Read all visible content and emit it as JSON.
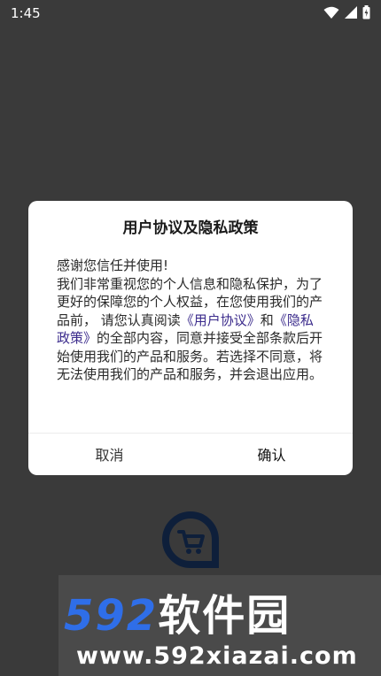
{
  "status_bar": {
    "time": "1:45",
    "icons": [
      "wifi-icon",
      "cell-signal-icon",
      "battery-charging-icon"
    ]
  },
  "dialog": {
    "title": "用户协议及隐私政策",
    "body": {
      "greeting": "感谢您信任并使用!",
      "p1": "我们非常重视您的个人信息和隐私保护，为了更好的保障您的个人权益，在您使用我们的产品前， 请您认真阅读",
      "link_user_agreement": "《用户协议》",
      "conj": "和",
      "link_privacy_policy": "《隐私政策》",
      "p2": "的全部内容，同意并接受全部条款后开始使用我们的产品和服务。若选择不同意，将无法使用我们的产品和服务，并会退出应用。"
    },
    "cancel_label": "取消",
    "confirm_label": "确认"
  },
  "colors": {
    "overlay": "#3a3a3a",
    "link": "#3b2b8c",
    "logo": "#0e1f3a",
    "watermark_blue": "#2f6ee8"
  },
  "watermark": {
    "brand_number": "592",
    "brand_text": "软件园",
    "url": "www.592xiazai.com"
  }
}
